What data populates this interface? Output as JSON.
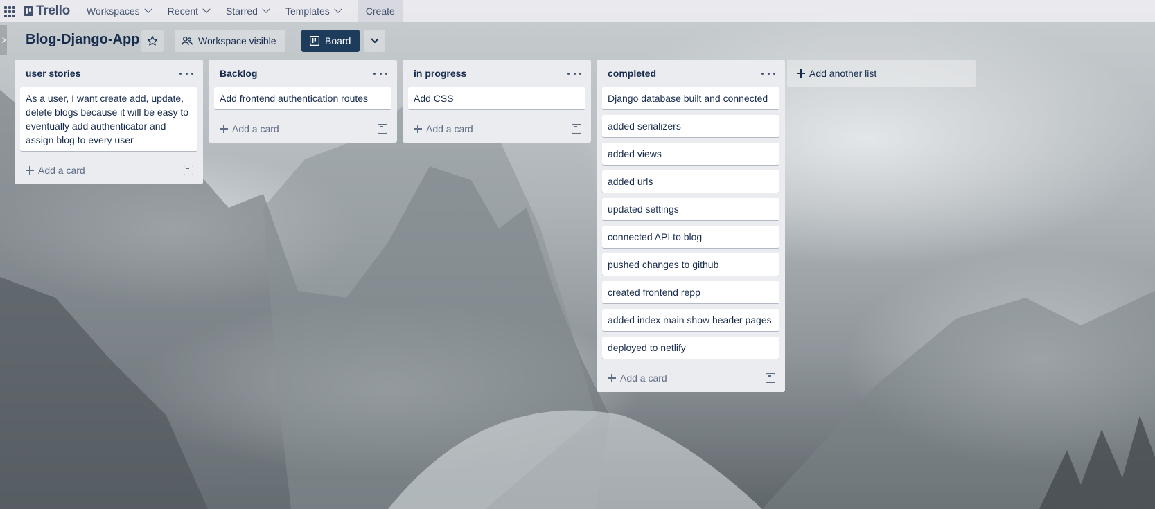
{
  "topbar": {
    "logo_text": "Trello",
    "workspaces_label": "Workspaces",
    "recent_label": "Recent",
    "starred_label": "Starred",
    "templates_label": "Templates",
    "create_label": "Create"
  },
  "board": {
    "title": "Blog-Django-App",
    "visibility_label": "Workspace visible",
    "view_label": "Board"
  },
  "lists": [
    {
      "title": "user stories",
      "cards": [
        "As a user, I want create add, update, delete blogs because it will be easy to eventually add authenticator and assign blog to every user"
      ],
      "add_card_label": "Add a card"
    },
    {
      "title": "Backlog",
      "cards": [
        "Add frontend authentication routes"
      ],
      "add_card_label": "Add a card"
    },
    {
      "title": "in progress",
      "cards": [
        "Add CSS"
      ],
      "add_card_label": "Add a card"
    },
    {
      "title": "completed",
      "cards": [
        "Django database built and connected",
        "added serializers",
        "added views",
        "added urls",
        "updated settings",
        "connected API to blog",
        "pushed changes to github",
        "created frontend repp",
        "added index main show header pages",
        "deployed to netlify"
      ],
      "add_card_label": "Add a card"
    }
  ],
  "add_list_label": "Add another list",
  "colors": {
    "board_button_bg": "#1d3c5c",
    "list_bg": "#ebecf0",
    "card_bg": "#ffffff",
    "text": "#172b4d"
  }
}
